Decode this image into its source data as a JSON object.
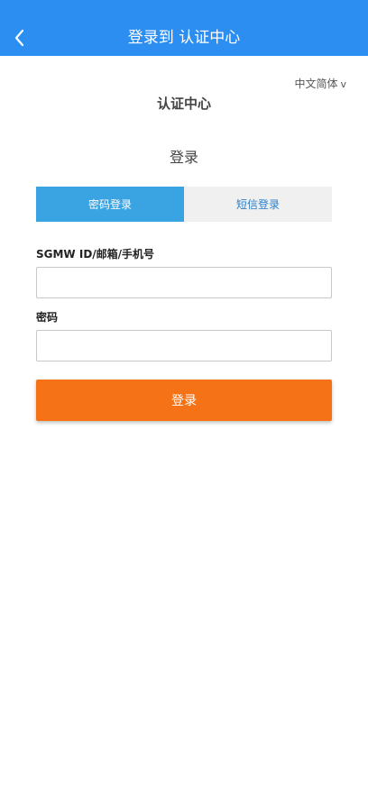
{
  "header": {
    "title": "登录到 认证中心",
    "back_icon": "chevron-left-icon"
  },
  "language": {
    "selected": "中文简体",
    "chevron": "v"
  },
  "center_title": "认证中心",
  "login_title": "登录",
  "tabs": [
    {
      "label": "密码登录",
      "active": true
    },
    {
      "label": "短信登录",
      "active": false
    }
  ],
  "form": {
    "account_label": "SGMW ID/邮箱/手机号",
    "account_value": "",
    "password_label": "密码",
    "password_value": "",
    "submit_label": "登录"
  },
  "colors": {
    "header": "#2d8ef2",
    "tab_active": "#3aa3e2",
    "tab_inactive": "#f0f0f0",
    "button": "#f57216"
  }
}
